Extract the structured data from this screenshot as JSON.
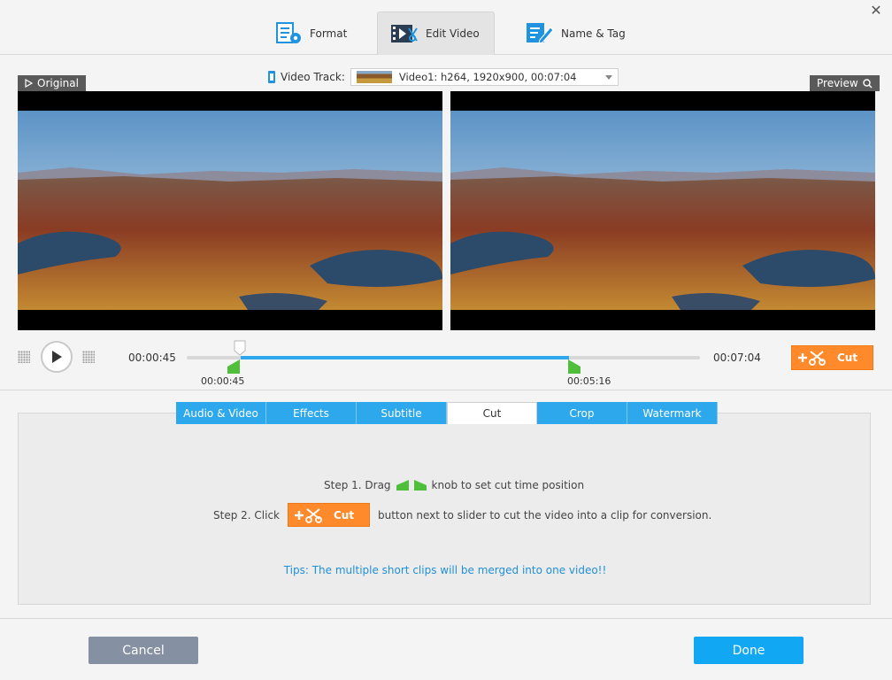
{
  "window": {
    "close_icon": "close-icon"
  },
  "top_tabs": [
    {
      "label": "Format",
      "icon": "format-icon"
    },
    {
      "label": "Edit Video",
      "icon": "edit-video-icon"
    },
    {
      "label": "Name & Tag",
      "icon": "name-tag-icon"
    }
  ],
  "video_track": {
    "label": "Video Track:",
    "selected": "Video1: h264, 1920x900, 00:07:04"
  },
  "panes": {
    "original": "Original",
    "preview": "Preview"
  },
  "playback": {
    "current_time": "00:00:45",
    "total_time": "00:07:04",
    "marker_start_time": "00:00:45",
    "marker_end_time": "00:05:16",
    "selection_start_fraction": 0.106,
    "selection_end_fraction": 0.745,
    "cut_label": "Cut"
  },
  "edit_tabs": [
    {
      "label": "Audio & Video"
    },
    {
      "label": "Effects"
    },
    {
      "label": "Subtitle"
    },
    {
      "label": "Cut"
    },
    {
      "label": "Crop"
    },
    {
      "label": "Watermark"
    }
  ],
  "cut_panel": {
    "step1_prefix": "Step 1. Drag",
    "step1_suffix": "knob to set cut time position",
    "step2_prefix": "Step 2. Click",
    "step2_suffix": "button next to slider to cut the video into a clip for conversion.",
    "cut_label": "Cut",
    "tips": "Tips: The multiple short clips will be merged into one video!!"
  },
  "footer": {
    "cancel": "Cancel",
    "done": "Done"
  },
  "colors": {
    "accent_blue": "#2ea8ec",
    "cut_orange": "#ff8a2b",
    "cancel_gray": "#8590a3",
    "marker_green": "#4fbf3b"
  }
}
